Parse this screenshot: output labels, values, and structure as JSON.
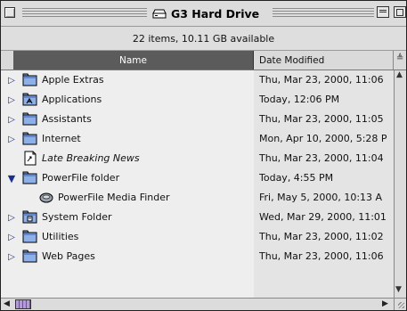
{
  "window": {
    "title": "G3 Hard Drive",
    "icon": "hard-drive-icon"
  },
  "header": {
    "info": "22 items, 10.11 GB available",
    "columns": {
      "name": "Name",
      "date": "Date Modified"
    },
    "sort_direction_icon": "sort-direction-icon"
  },
  "items": [
    {
      "name": "Apple Extras",
      "date": "Thu, Mar 23, 2000, 11:06",
      "expander": "collapsed",
      "icon": "folder-icon",
      "italic": false,
      "indent": 0
    },
    {
      "name": "Applications",
      "date": "Today, 12:06 PM",
      "expander": "collapsed",
      "icon": "applications-folder-icon",
      "italic": false,
      "indent": 0
    },
    {
      "name": "Assistants",
      "date": "Thu, Mar 23, 2000, 11:05",
      "expander": "collapsed",
      "icon": "folder-icon",
      "italic": false,
      "indent": 0
    },
    {
      "name": "Internet",
      "date": "Mon, Apr 10, 2000, 5:28 P",
      "expander": "collapsed",
      "icon": "folder-icon",
      "italic": false,
      "indent": 0
    },
    {
      "name": "Late Breaking News",
      "date": "Thu, Mar 23, 2000, 11:04",
      "expander": "none",
      "icon": "alias-document-icon",
      "italic": true,
      "indent": 0
    },
    {
      "name": "PowerFile folder",
      "date": "Today, 4:55 PM",
      "expander": "expanded",
      "icon": "folder-icon",
      "italic": false,
      "indent": 0
    },
    {
      "name": "PowerFile Media Finder",
      "date": "Fri, May 5, 2000, 10:13 A",
      "expander": "none",
      "icon": "application-icon",
      "italic": false,
      "indent": 1
    },
    {
      "name": "System Folder",
      "date": "Wed, Mar 29, 2000, 11:01",
      "expander": "collapsed",
      "icon": "system-folder-icon",
      "italic": false,
      "indent": 0
    },
    {
      "name": "Utilities",
      "date": "Thu, Mar 23, 2000, 11:02",
      "expander": "collapsed",
      "icon": "folder-icon",
      "italic": false,
      "indent": 0
    },
    {
      "name": "Web Pages",
      "date": "Thu, Mar 23, 2000, 11:06",
      "expander": "collapsed",
      "icon": "folder-icon",
      "italic": false,
      "indent": 0
    }
  ],
  "colors": {
    "folder": "#8db0e8",
    "folder_dark": "#3f5fae",
    "expander": "#1d2e8c",
    "scroll_thumb": "#b49ad8"
  }
}
